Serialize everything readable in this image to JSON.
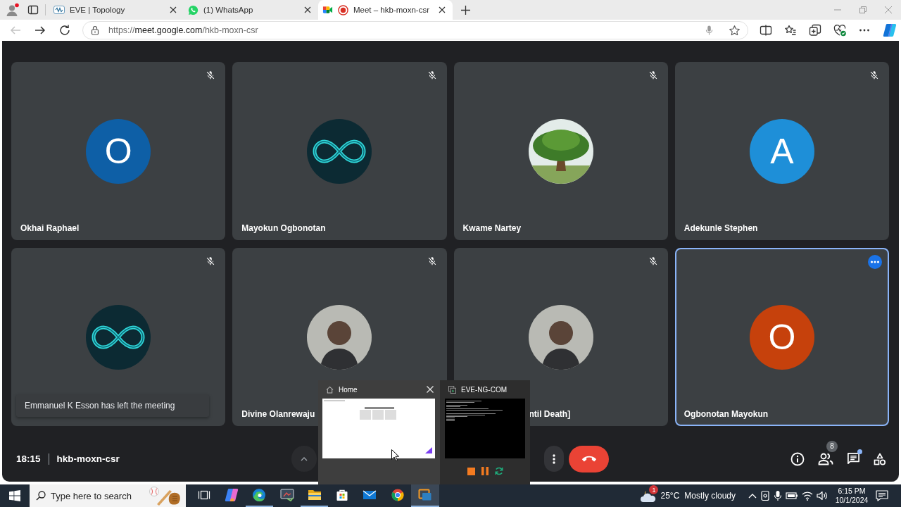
{
  "browser": {
    "tabs": [
      {
        "kind": "eve",
        "title": "EVE | Topology",
        "recording": false,
        "selected": false
      },
      {
        "kind": "whatsapp",
        "title": "(1) WhatsApp",
        "recording": false,
        "selected": false
      },
      {
        "kind": "meet",
        "title": "Meet – hkb-moxn-csr",
        "recording": true,
        "selected": true
      }
    ],
    "nav": {
      "back_disabled": true
    },
    "address": {
      "scheme": "https://",
      "host": "meet.google.com",
      "path": "/hkb-moxn-csr"
    }
  },
  "meeting": {
    "tiles": [
      {
        "name": "Okhai Raphael",
        "avatar": {
          "kind": "letter",
          "letter": "O",
          "color": "#0e5fa6"
        },
        "muted": true,
        "selected": false
      },
      {
        "name": "Mayokun Ogbonotan",
        "avatar": {
          "kind": "infinity"
        },
        "muted": true,
        "selected": false
      },
      {
        "name": "Kwame Nartey",
        "avatar": {
          "kind": "tree"
        },
        "muted": true,
        "selected": false
      },
      {
        "name": "Adekunle Stephen",
        "avatar": {
          "kind": "letter",
          "letter": "A",
          "color": "#1e8fd8"
        },
        "muted": true,
        "selected": false
      },
      {
        "avatar": {
          "kind": "infinity"
        },
        "muted": true,
        "selected": false
      },
      {
        "name": "Divine Olanrewaju",
        "avatar": {
          "kind": "photo"
        },
        "muted": true,
        "selected": false
      },
      {
        "name": "ntil Death]",
        "avatar": {
          "kind": "photo"
        },
        "muted": true,
        "selected": false
      },
      {
        "name": "Ogbonotan Mayokun",
        "avatar": {
          "kind": "letter",
          "letter": "O",
          "color": "#c6410c"
        },
        "muted": false,
        "selected": true
      }
    ],
    "notification": "Emmanuel K Esson has left the meeting",
    "clock": "18:15",
    "code": "hkb-moxn-csr",
    "participant_count": "8",
    "chat_unread": true
  },
  "preview": {
    "windows": [
      {
        "kind": "document",
        "title": "Home",
        "hovered": true
      },
      {
        "kind": "terminal",
        "title": "EVE-NG-COM",
        "hovered": false
      }
    ]
  },
  "taskbar": {
    "search": {
      "placeholder": "Type here to search"
    },
    "apps": [
      {
        "kind": "task-view",
        "running": false,
        "selected": false
      },
      {
        "kind": "copilot",
        "running": false,
        "selected": false
      },
      {
        "kind": "edge",
        "running": true,
        "selected": false
      },
      {
        "kind": "snip",
        "running": false,
        "selected": false
      },
      {
        "kind": "explorer",
        "running": true,
        "selected": false
      },
      {
        "kind": "store",
        "running": false,
        "selected": false
      },
      {
        "kind": "mail",
        "running": false,
        "selected": false
      },
      {
        "kind": "chrome",
        "running": false,
        "selected": false
      },
      {
        "kind": "eve",
        "running": true,
        "selected": true
      }
    ],
    "weather": {
      "badge": "1",
      "temperature": "25°C",
      "condition": "Mostly cloudy"
    },
    "time": "6:15 PM",
    "date": "10/1/2024"
  }
}
